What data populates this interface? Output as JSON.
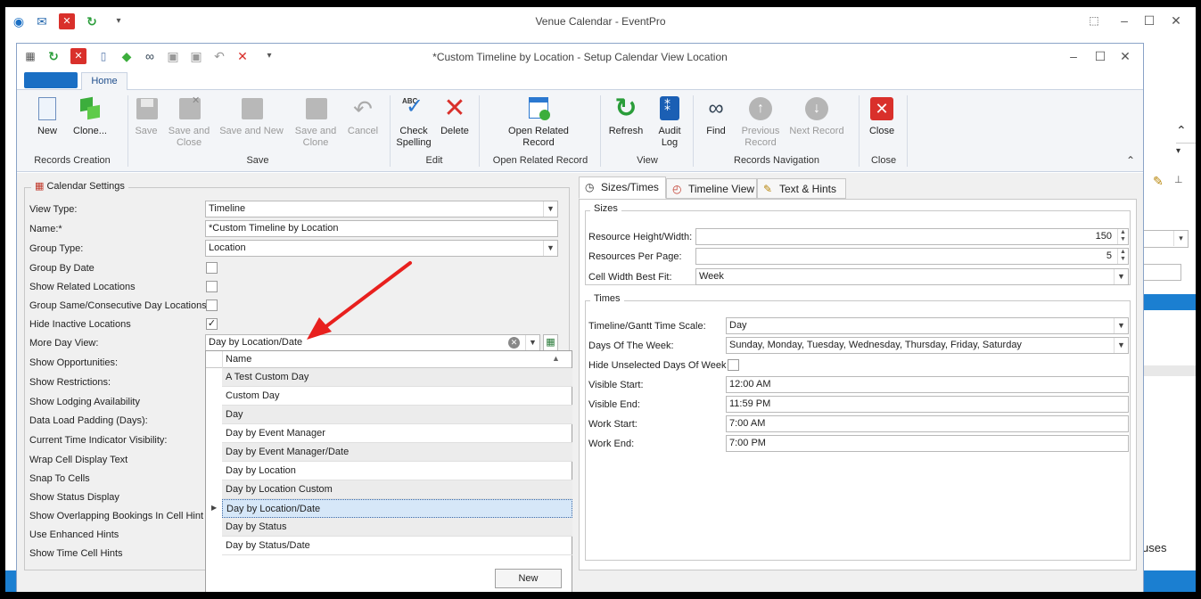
{
  "outer": {
    "title": "Venue Calendar - EventPro",
    "right_fragments": {
      "overflow_text": "uses"
    }
  },
  "dialog": {
    "title": "*Custom Timeline by Location - Setup Calendar View Location",
    "tab_home": "Home"
  },
  "ribbon": {
    "new": "New",
    "clone": "Clone...",
    "save": "Save",
    "save_and_close": "Save and Close",
    "save_and_new": "Save and New",
    "save_and_clone": "Save and Clone",
    "cancel": "Cancel",
    "check_spelling": "Check Spelling",
    "delete": "Delete",
    "open_related_record": "Open Related Record",
    "refresh": "Refresh",
    "audit_log": "Audit Log",
    "find": "Find",
    "previous_record": "Previous Record",
    "next_record": "Next Record",
    "close": "Close",
    "groups": {
      "records_creation": "Records Creation",
      "save": "Save",
      "edit": "Edit",
      "open_related_record": "Open Related Record",
      "view": "View",
      "records_navigation": "Records Navigation",
      "close": "Close"
    },
    "abc": "ABC"
  },
  "calendar_settings": {
    "legend": "Calendar Settings",
    "view_type_label": "View Type:",
    "view_type": "Timeline",
    "name_label": "Name:*",
    "name": "*Custom Timeline by Location",
    "group_type_label": "Group Type:",
    "group_type": "Location",
    "group_by_date": "Group By Date",
    "show_related_locations": "Show Related Locations",
    "group_same_day": "Group Same/Consecutive Day Locations",
    "hide_inactive": "Hide Inactive Locations",
    "more_day_view_label": "More Day View:",
    "more_day_view": "Day by Location/Date",
    "show_opportunities": "Show Opportunities:",
    "show_restrictions": "Show Restrictions:",
    "show_lodging": "Show Lodging Availability",
    "data_load_padding": "Data Load Padding (Days):",
    "current_time_indicator": "Current Time Indicator Visibility:",
    "wrap_cell": "Wrap Cell Display Text",
    "snap_to_cells": "Snap To Cells",
    "show_status_display": "Show Status Display",
    "show_overlapping": "Show Overlapping Bookings In Cell Hint",
    "use_enhanced_hints": "Use Enhanced Hints",
    "show_time_cell_hints": "Show Time Cell Hints"
  },
  "dropdown": {
    "column_header": "Name",
    "items": [
      "A Test Custom Day",
      "Custom Day",
      "Day",
      "Day by Event Manager",
      "Day by Event Manager/Date",
      "Day by Location",
      "Day by Location Custom",
      "Day by Location/Date",
      "Day by Status",
      "Day by Status/Date"
    ],
    "selected_index": 7,
    "new_button": "New"
  },
  "right_tabs": {
    "sizes_times": "Sizes/Times",
    "timeline_view": "Timeline View",
    "text_hints": "Text & Hints"
  },
  "sizes": {
    "legend": "Sizes",
    "resource_hw_label": "Resource Height/Width:",
    "resource_hw": "150",
    "resources_per_page_label": "Resources Per Page:",
    "resources_per_page": "5",
    "cell_width_label": "Cell Width Best Fit:",
    "cell_width": "Week"
  },
  "times": {
    "legend": "Times",
    "scale_label": "Timeline/Gantt Time Scale:",
    "scale": "Day",
    "days_label": "Days Of The Week:",
    "days": "Sunday, Monday, Tuesday, Wednesday, Thursday, Friday, Saturday",
    "hide_unselected_label": "Hide Unselected Days Of Week",
    "visible_start_label": "Visible Start:",
    "visible_start": "12:00 AM",
    "visible_end_label": "Visible End:",
    "visible_end": "11:59 PM",
    "work_start_label": "Work Start:",
    "work_start": "7:00 AM",
    "work_end_label": "Work End:",
    "work_end": "7:00 PM"
  },
  "colors": {
    "accent": "#1b7fd1",
    "arrow": "#e8201e"
  }
}
